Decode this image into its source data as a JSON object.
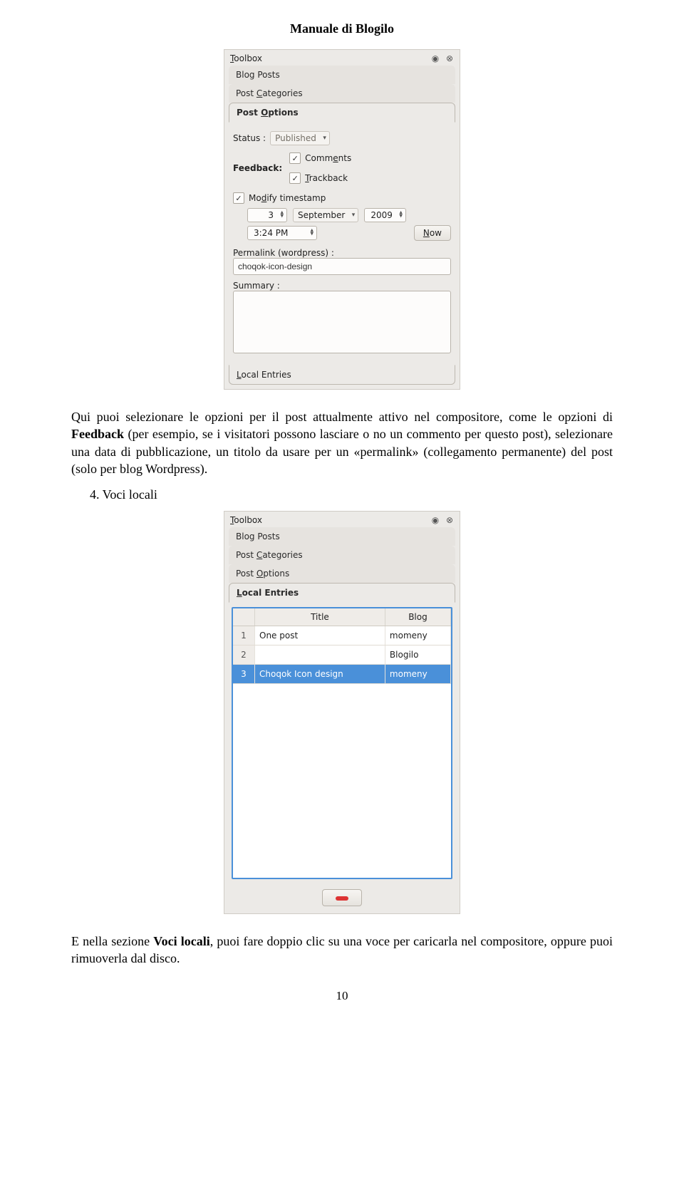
{
  "doc": {
    "title": "Manuale di Blogilo",
    "page_number": "10",
    "para1_pre": "Qui puoi selezionare le opzioni per il post attualmente attivo nel compositore, come le opzioni di ",
    "para1_bold": "Feedback",
    "para1_post": " (per esempio, se i visitatori possono lasciare o no un commento per questo post), selezionare una data di pubblicazione, un titolo da usare per un «permalink» (collegamento permanente) del post (solo per blog Wordpress).",
    "list_item": "4. Voci locali",
    "para2_pre": "E nella sezione ",
    "para2_bold": "Voci locali",
    "para2_post": ", puoi fare doppio clic su una voce per caricarla nel compositore, oppure puoi rimuoverla dal disco."
  },
  "shot1": {
    "toolbox": "Toolbox",
    "tab_blog_posts": "Blog Posts",
    "tab_post_categories": "Post Categories",
    "tab_post_options": "Post Options",
    "status_label": "Status :",
    "status_value": "Published",
    "feedback_label": "Feedback:",
    "comments_label": "Comments",
    "trackback_label": "Trackback",
    "modify_ts_label": "Modify timestamp",
    "day": "3",
    "month": "September",
    "year": "2009",
    "time": "3:24 PM",
    "now_label": "Now",
    "permalink_label": "Permalink (wordpress) :",
    "permalink_value": "choqok-icon-design",
    "summary_label": "Summary :",
    "local_entries": "Local Entries"
  },
  "shot2": {
    "toolbox": "Toolbox",
    "tab_blog_posts": "Blog Posts",
    "tab_post_categories": "Post Categories",
    "tab_post_options": "Post Options",
    "local_entries": "Local Entries",
    "col_title": "Title",
    "col_blog": "Blog",
    "rows": [
      {
        "idx": "1",
        "title": "One post",
        "blog": "momeny"
      },
      {
        "idx": "2",
        "title": "",
        "blog": "Blogilo"
      },
      {
        "idx": "3",
        "title": "Choqok Icon design",
        "blog": "momeny"
      }
    ]
  }
}
